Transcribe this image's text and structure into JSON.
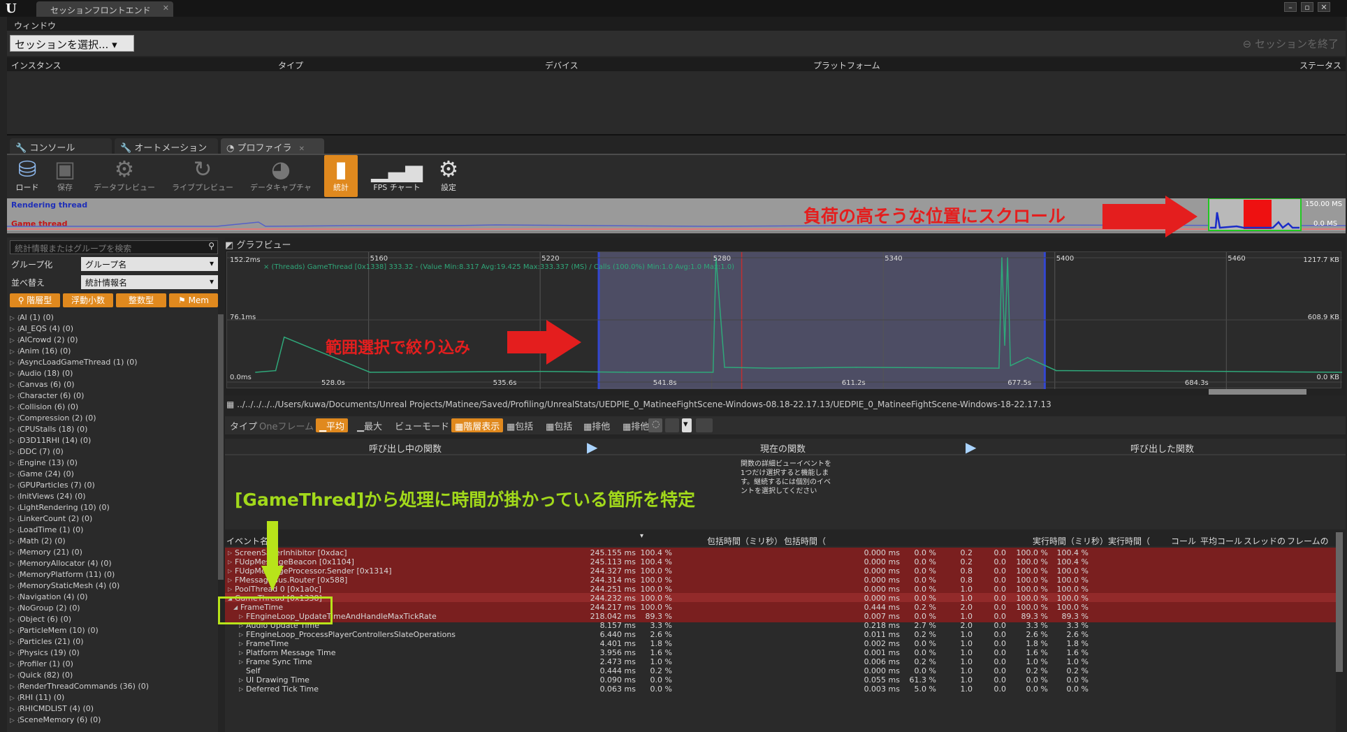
{
  "window": {
    "title": "セッションフロントエンド",
    "logo": "U"
  },
  "menu": {
    "items": [
      "ウィンドウ"
    ]
  },
  "session": {
    "select_label": "セッションを選択...",
    "end_label": "セッションを終了"
  },
  "instances": {
    "columns": [
      "インスタンス",
      "タイプ",
      "デバイス",
      "プラットフォーム",
      "ステータス"
    ]
  },
  "tabs": [
    {
      "label": "コンソール",
      "icon": "wrench-icon"
    },
    {
      "label": "オートメーション",
      "icon": "wrench-icon"
    },
    {
      "label": "プロファイラ",
      "icon": "profiler-icon"
    }
  ],
  "toolbar": [
    {
      "label": "ロード",
      "icon": "load-icon",
      "state": "enabled"
    },
    {
      "label": "保存",
      "icon": "save-icon",
      "state": "disabled"
    },
    {
      "label": "データプレビュー",
      "icon": "data-preview-icon",
      "state": "disabled"
    },
    {
      "label": "ライブプレビュー",
      "icon": "live-preview-icon",
      "state": "disabled"
    },
    {
      "label": "データキャプチャ",
      "icon": "data-capture-icon",
      "state": "disabled"
    },
    {
      "label": "統計",
      "icon": "stats-icon",
      "state": "active"
    },
    {
      "label": "FPS チャート",
      "icon": "fps-chart-icon",
      "state": "enabled"
    },
    {
      "label": "設定",
      "icon": "gear-icon",
      "state": "enabled"
    }
  ],
  "overview": {
    "thread_a": "Rendering thread",
    "thread_b": "Game thread",
    "max_label": "150.00 MS",
    "min_label": "0.0 MS"
  },
  "annotations": {
    "scroll": "負荷の高そうな位置にスクロール",
    "range": "範囲選択で絞り込み",
    "gamethread": "[GameThred]から処理に時間が掛かっている箇所を特定"
  },
  "filter": {
    "search_placeholder": "統計情報またはグループを検索",
    "group_label": "グループ化",
    "group_value": "グループ名",
    "sort_label": "並べ替え",
    "sort_value": "統計情報名",
    "type_buttons": [
      "階層型",
      "浮動小数",
      "整数型",
      "Mem"
    ]
  },
  "stat_groups": [
    "AI (1) (0)",
    "AI_EQS (4) (0)",
    "AICrowd (2) (0)",
    "Anim (16) (0)",
    "AsyncLoadGameThread (1) (0)",
    "Audio (18) (0)",
    "Canvas (6) (0)",
    "Character (6) (0)",
    "Collision (6) (0)",
    "Compression (2) (0)",
    "CPUStalls (18) (0)",
    "D3D11RHI (14) (0)",
    "DDC (7) (0)",
    "Engine (13) (0)",
    "Game (24) (0)",
    "GPUParticles (7) (0)",
    "InitViews (24) (0)",
    "LightRendering (10) (0)",
    "LinkerCount (2) (0)",
    "LoadTime (1) (0)",
    "Math (2) (0)",
    "Memory (21) (0)",
    "MemoryAllocator (4) (0)",
    "MemoryPlatform (11) (0)",
    "MemoryStaticMesh (4) (0)",
    "Navigation (4) (0)",
    "NoGroup (2) (0)",
    "Object (6) (0)",
    "ParticleMem (10) (0)",
    "Particles (21) (0)",
    "Physics (19) (0)",
    "Profiler (1) (0)",
    "Quick (82) (0)",
    "RenderThreadCommands (36) (0)",
    "RHI (11) (0)",
    "RHICMDLIST (4) (0)",
    "SceneMemory (6) (0)"
  ],
  "graph": {
    "title": "グラフビュー",
    "y_labels_left": [
      "152.2ms",
      "76.1ms",
      "0.0ms"
    ],
    "y_labels_right": [
      "1217.7 KB",
      "608.9 KB",
      "0.0 KB"
    ],
    "frame_labels": [
      "5160",
      "5220",
      "5280",
      "5340",
      "5400",
      "5460"
    ],
    "time_labels": [
      "528.0s",
      "535.6s",
      "541.8s",
      "611.2s",
      "677.5s",
      "684.3s"
    ],
    "legend": "(Threads) GameThread [0x1338] 333.32 - (Value Min:8.317 Avg:19.425 Max:333.337 (MS) / Calls (100.0%) Min:1.0 Avg:1.0 Max:1.0)"
  },
  "chart_data": {
    "type": "line",
    "title": "グラフビュー",
    "series": [
      {
        "name": "(Threads) GameThread [0x1338]",
        "x": [
          5120,
          5127,
          5130,
          5160,
          5220,
          5250,
          5280,
          5281,
          5284,
          5300,
          5330,
          5380,
          5381,
          5382,
          5383,
          5384,
          5390,
          5400,
          5460,
          5500
        ],
        "values": [
          12,
          14,
          55,
          12,
          13,
          12,
          12,
          152,
          18,
          17,
          18,
          17,
          152,
          45,
          152,
          20,
          30,
          14,
          13,
          12
        ]
      }
    ],
    "xlabel": "",
    "ylabel": "",
    "ylim": [
      0,
      152.2
    ]
  },
  "file_path": "../../../../../Users/kuwa/Documents/Unreal Projects/Matinee/Saved/Profiling/UnrealStats/UEDPIE_0_MatineeFightScene-Windows-08.18-22.17.13/UEDPIE_0_MatineeFightScene-Windows-18-22.17.13",
  "event_toolbar": {
    "type_label": "タイプ",
    "type_value": "Oneフレーム",
    "btn_avg": "平均",
    "btn_max": "最大",
    "view_mode": "ビューモード",
    "btn_hier": "階層表示",
    "btn_incl1": "包括",
    "btn_incl2": "包括",
    "btn_excl1": "排他",
    "btn_excl2": "排他"
  },
  "function_panels": {
    "callers": "呼び出し中の関数",
    "current": "現在の関数",
    "callees": "呼び出した関数",
    "hint": "関数の詳細ビューイベントを1つだけ選択すると機能します。継続するには個別のイベントを選択してください"
  },
  "table": {
    "headers": [
      "イベント名",
      "包括時間（ミリ秒）",
      "包括時間（",
      "実行時間（ミリ秒）",
      "実行時間（",
      "コール",
      "平均コール",
      "スレッドの",
      "フレームの"
    ],
    "rows": [
      {
        "name": "ScreenSaverInhibitor [0xdac]",
        "depth": 0,
        "tri": "▷",
        "incl": "245.155 ms",
        "inclp": "100.4 %",
        "excl": "0.000 ms",
        "exclp": "0.0 %",
        "calls": "0.2",
        "avg": "0.0",
        "thr": "100.0 %",
        "frm": "100.4 %",
        "hl": true
      },
      {
        "name": "FUdpMessageBeacon [0x1104]",
        "depth": 0,
        "tri": "▷",
        "incl": "245.113 ms",
        "inclp": "100.4 %",
        "excl": "0.000 ms",
        "exclp": "0.0 %",
        "calls": "0.2",
        "avg": "0.0",
        "thr": "100.0 %",
        "frm": "100.4 %",
        "hl": true
      },
      {
        "name": "FUdpMessageProcessor.Sender [0x1314]",
        "depth": 0,
        "tri": "▷",
        "incl": "244.327 ms",
        "inclp": "100.0 %",
        "excl": "0.000 ms",
        "exclp": "0.0 %",
        "calls": "0.8",
        "avg": "0.0",
        "thr": "100.0 %",
        "frm": "100.0 %",
        "hl": true
      },
      {
        "name": "FMessageBus.Router [0x588]",
        "depth": 0,
        "tri": "▷",
        "incl": "244.314 ms",
        "inclp": "100.0 %",
        "excl": "0.000 ms",
        "exclp": "0.0 %",
        "calls": "0.8",
        "avg": "0.0",
        "thr": "100.0 %",
        "frm": "100.0 %",
        "hl": true
      },
      {
        "name": "PoolThread 0 [0x1a0c]",
        "depth": 0,
        "tri": "▷",
        "incl": "244.251 ms",
        "inclp": "100.0 %",
        "excl": "0.000 ms",
        "exclp": "0.0 %",
        "calls": "1.0",
        "avg": "0.0",
        "thr": "100.0 %",
        "frm": "100.0 %",
        "hl": true
      },
      {
        "name": "GameThread [0x1338]",
        "depth": 0,
        "tri": "◢",
        "incl": "244.232 ms",
        "inclp": "100.0 %",
        "excl": "0.000 ms",
        "exclp": "0.0 %",
        "calls": "1.0",
        "avg": "0.0",
        "thr": "100.0 %",
        "frm": "100.0 %",
        "hl": true
      },
      {
        "name": "FrameTime",
        "depth": 1,
        "tri": "◢",
        "incl": "244.217 ms",
        "inclp": "100.0 %",
        "excl": "0.444 ms",
        "exclp": "0.2 %",
        "calls": "2.0",
        "avg": "0.0",
        "thr": "100.0 %",
        "frm": "100.0 %",
        "hl": true
      },
      {
        "name": "FEngineLoop_UpdateTimeAndHandleMaxTickRate",
        "depth": 2,
        "tri": "▷",
        "incl": "218.042 ms",
        "inclp": "89.3 %",
        "excl": "0.007 ms",
        "exclp": "0.0 %",
        "calls": "1.0",
        "avg": "0.0",
        "thr": "89.3 %",
        "frm": "89.3 %",
        "hl": true
      },
      {
        "name": "Audio Update Time",
        "depth": 2,
        "tri": "▷",
        "incl": "8.157 ms",
        "inclp": "3.3 %",
        "excl": "0.218 ms",
        "exclp": "2.7 %",
        "calls": "2.0",
        "avg": "0.0",
        "thr": "3.3 %",
        "frm": "3.3 %",
        "hl": false
      },
      {
        "name": "FEngineLoop_ProcessPlayerControllersSlateOperations",
        "depth": 2,
        "tri": "▷",
        "incl": "6.440 ms",
        "inclp": "2.6 %",
        "excl": "0.011 ms",
        "exclp": "0.2 %",
        "calls": "1.0",
        "avg": "0.0",
        "thr": "2.6 %",
        "frm": "2.6 %",
        "hl": false
      },
      {
        "name": "FrameTime",
        "depth": 2,
        "tri": "▷",
        "incl": "4.401 ms",
        "inclp": "1.8 %",
        "excl": "0.002 ms",
        "exclp": "0.0 %",
        "calls": "1.0",
        "avg": "0.0",
        "thr": "1.8 %",
        "frm": "1.8 %",
        "hl": false
      },
      {
        "name": "Platform Message Time",
        "depth": 2,
        "tri": "▷",
        "incl": "3.956 ms",
        "inclp": "1.6 %",
        "excl": "0.001 ms",
        "exclp": "0.0 %",
        "calls": "1.0",
        "avg": "0.0",
        "thr": "1.6 %",
        "frm": "1.6 %",
        "hl": false
      },
      {
        "name": "Frame Sync Time",
        "depth": 2,
        "tri": "▷",
        "incl": "2.473 ms",
        "inclp": "1.0 %",
        "excl": "0.006 ms",
        "exclp": "0.2 %",
        "calls": "1.0",
        "avg": "0.0",
        "thr": "1.0 %",
        "frm": "1.0 %",
        "hl": false
      },
      {
        "name": "Self",
        "depth": 2,
        "tri": "",
        "incl": "0.444 ms",
        "inclp": "0.2 %",
        "excl": "0.000 ms",
        "exclp": "0.0 %",
        "calls": "1.0",
        "avg": "0.0",
        "thr": "0.2 %",
        "frm": "0.2 %",
        "hl": false
      },
      {
        "name": "UI Drawing Time",
        "depth": 2,
        "tri": "▷",
        "incl": "0.090 ms",
        "inclp": "0.0 %",
        "excl": "0.055 ms",
        "exclp": "61.3 %",
        "calls": "1.0",
        "avg": "0.0",
        "thr": "0.0 %",
        "frm": "0.0 %",
        "hl": false
      },
      {
        "name": "Deferred Tick Time",
        "depth": 2,
        "tri": "▷",
        "incl": "0.063 ms",
        "inclp": "0.0 %",
        "excl": "0.003 ms",
        "exclp": "5.0 %",
        "calls": "1.0",
        "avg": "0.0",
        "thr": "0.0 %",
        "frm": "0.0 %",
        "hl": false
      }
    ]
  },
  "colors": {
    "accent": "#e0891e",
    "highlight_row": "#7a1f1f",
    "annotation_red": "#e41e1e",
    "annotation_green": "#a2d91b",
    "graph_line": "#2fa87a"
  }
}
